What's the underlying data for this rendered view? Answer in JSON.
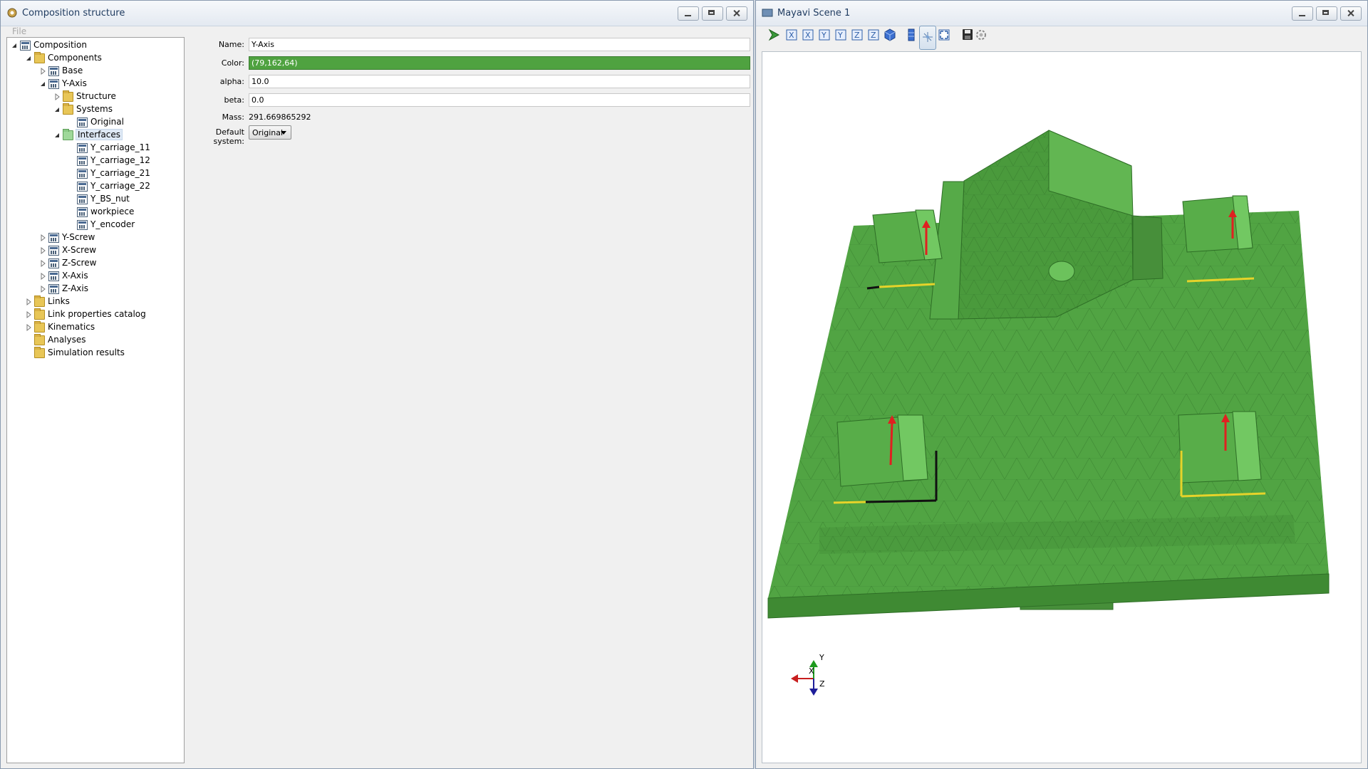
{
  "left_window": {
    "title": "Composition structure",
    "menu": {
      "file": "File"
    },
    "tree": {
      "composition": "Composition",
      "components": "Components",
      "base": "Base",
      "y_axis": "Y-Axis",
      "structure": "Structure",
      "systems": "Systems",
      "original": "Original",
      "interfaces": "Interfaces",
      "interface_items": [
        "Y_carriage_11",
        "Y_carriage_12",
        "Y_carriage_21",
        "Y_carriage_22",
        "Y_BS_nut",
        "workpiece",
        "Y_encoder"
      ],
      "other_components": [
        "Y-Screw",
        "X-Screw",
        "Z-Screw",
        "X-Axis",
        "Z-Axis"
      ],
      "top_level": [
        "Links",
        "Link properties catalog",
        "Kinematics",
        "Analyses",
        "Simulation results"
      ]
    },
    "properties": {
      "name_label": "Name:",
      "name_value": "Y-Axis",
      "color_label": "Color:",
      "color_value": "(79,162,64)",
      "alpha_label": "alpha:",
      "alpha_value": "10.0",
      "beta_label": "beta:",
      "beta_value": "0.0",
      "mass_label": "Mass:",
      "mass_value": "291.669865292",
      "default_system_label": "Default system:",
      "default_system_value": "Original"
    }
  },
  "right_window": {
    "title": "Mayavi Scene 1",
    "axes": {
      "x": "X",
      "y": "Y",
      "z": "Z"
    }
  },
  "colors": {
    "component_color": "#4fa240",
    "selection": "#dfe9f5"
  }
}
